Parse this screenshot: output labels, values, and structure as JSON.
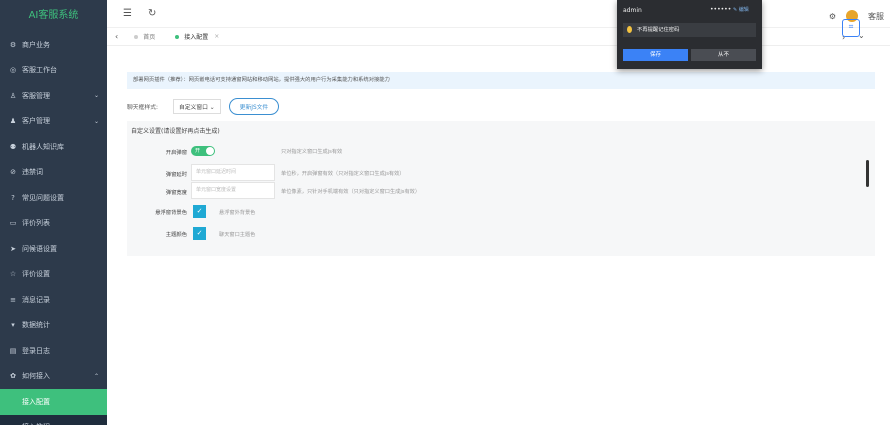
{
  "sidebar": {
    "brand": "AI客服系统",
    "items": [
      {
        "label": "商户业务",
        "icon": "gear-icon",
        "arrow": ""
      },
      {
        "label": "客服工作台",
        "icon": "headset-icon",
        "arrow": ""
      },
      {
        "label": "客服管理",
        "icon": "user-icon",
        "arrow": "⌄"
      },
      {
        "label": "客户管理",
        "icon": "users-icon",
        "arrow": "⌄"
      },
      {
        "label": "机器人知识库",
        "icon": "robot-icon",
        "arrow": ""
      },
      {
        "label": "违禁词",
        "icon": "ban-icon",
        "arrow": ""
      },
      {
        "label": "常见问题设置",
        "icon": "question-icon",
        "arrow": ""
      },
      {
        "label": "评价列表",
        "icon": "comment-icon",
        "arrow": ""
      },
      {
        "label": "问候语设置",
        "icon": "send-icon",
        "arrow": ""
      },
      {
        "label": "评价设置",
        "icon": "rate-icon",
        "arrow": ""
      },
      {
        "label": "消息记录",
        "icon": "message-icon",
        "arrow": ""
      },
      {
        "label": "数据统计",
        "icon": "stats-icon",
        "arrow": ""
      },
      {
        "label": "登录日志",
        "icon": "log-icon",
        "arrow": ""
      },
      {
        "label": "如何接入",
        "icon": "setting-icon",
        "arrow": "⌃"
      }
    ],
    "submenu": [
      {
        "label": "接入配置"
      },
      {
        "label": "接入教程"
      }
    ]
  },
  "topbar": {
    "menu_glyph": "☰",
    "refresh_glyph": "↻"
  },
  "tabs": [
    {
      "label": "首页"
    },
    {
      "label": "接入配置"
    }
  ],
  "tabs_nav": {
    "left": "‹",
    "right": "›",
    "down": "⌄"
  },
  "header_right": {
    "user_name": "客服"
  },
  "notice_text": "部署网页插件（推荐）：网页嵌电话可支持通窗网站和移动网站，提供强大的用户行为采集能力和系统对接能力",
  "chat_style": {
    "label": "聊天框样式:",
    "selected": "自定义窗口 ⌄",
    "upload_label": "更新JS文件"
  },
  "custom": {
    "title": "自定义设置(请设置好再点击生成)",
    "switch_label": "开启弹窗",
    "switch_value": "开",
    "switch_hint": "只对指定义窗口生成js有效",
    "popup_time_label": "弹窗延时",
    "popup_time_placeholder": "单元窗口延迟时间",
    "popup_time_hint": "单位秒，开启弹窗有效（只对指定义窗口生成js有效）",
    "popup_width_label": "弹窗宽度",
    "popup_width_placeholder": "单元窗口宽度设置",
    "popup_width_hint": "单位像素，只针对手机端有效（只对指定义窗口生成js有效）",
    "float_bg_label": "悬浮窗背景色",
    "float_bg_hint": "悬浮窗外背景色",
    "theme_label": "主题颜色",
    "theme_hint": "聊天窗口主题色",
    "color_value": "#1fa9d4"
  },
  "popup": {
    "title": "admin",
    "dots": "••••••",
    "edit": "✎ 编辑",
    "message": "不再提醒记住密码",
    "save": "保存",
    "never": "从不"
  },
  "corner_icon": "scan-icon"
}
